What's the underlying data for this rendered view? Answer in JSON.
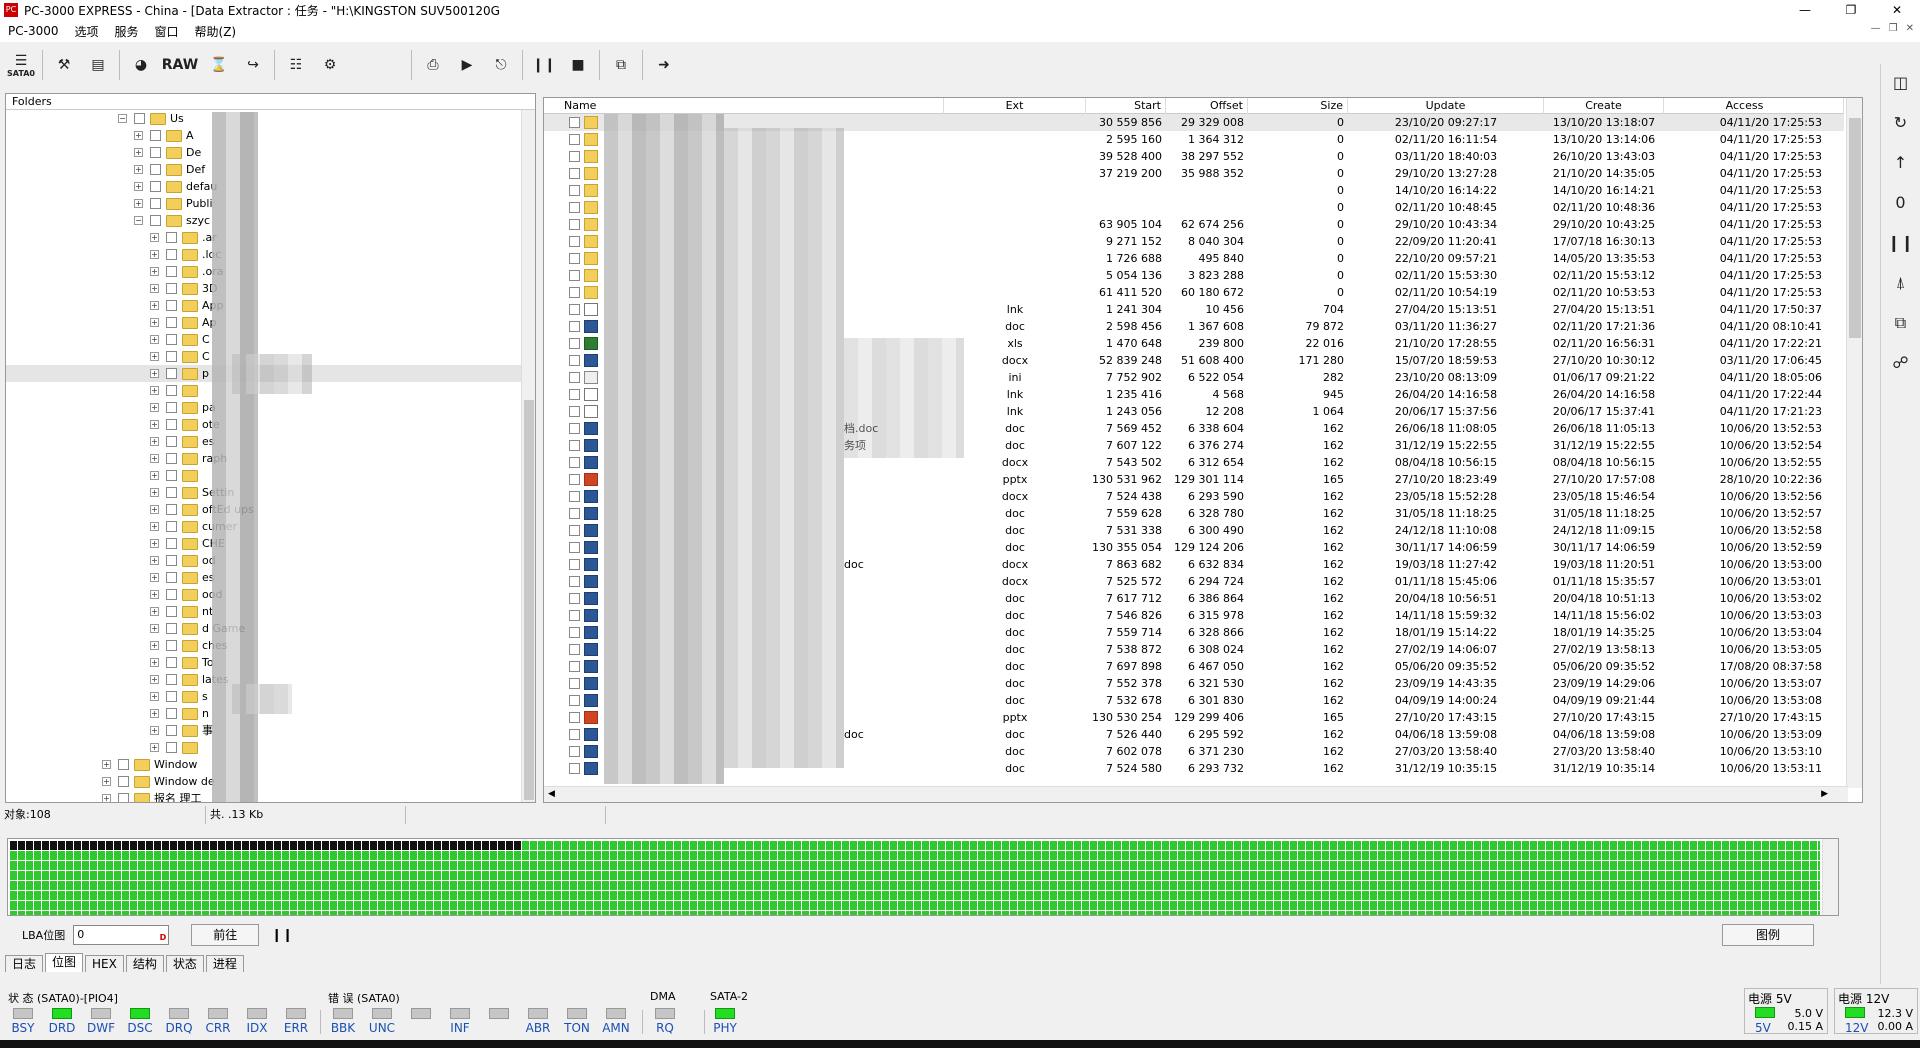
{
  "window": {
    "title": "PC-3000 EXPRESS - China - [Data Extractor : 任务 - \"H:\\KINGSTON SUV500120G"
  },
  "menu": {
    "items": [
      "PC-3000",
      "选项",
      "服务",
      "窗口",
      "帮助(Z)"
    ]
  },
  "toolbar": {
    "sata_label": "SATA0",
    "raw_label": "RAW"
  },
  "folders": {
    "header": "Folders",
    "items": [
      {
        "label": "Us",
        "indent": 0,
        "exp": "−"
      },
      {
        "label": "A",
        "indent": 1,
        "exp": "+"
      },
      {
        "label": "De",
        "indent": 1,
        "exp": "+"
      },
      {
        "label": "Def",
        "indent": 1,
        "exp": "+"
      },
      {
        "label": "defau",
        "indent": 1,
        "exp": "+"
      },
      {
        "label": "Publi",
        "indent": 1,
        "exp": "+"
      },
      {
        "label": "szyc",
        "indent": 1,
        "exp": "−"
      },
      {
        "label": ".ar",
        "indent": 2,
        "exp": "+"
      },
      {
        "label": ".loc",
        "indent": 2,
        "exp": "+"
      },
      {
        "label": ".ora",
        "indent": 2,
        "exp": "+"
      },
      {
        "label": "3D",
        "indent": 2,
        "exp": "+"
      },
      {
        "label": "App",
        "indent": 2,
        "exp": "+"
      },
      {
        "label": "Ap",
        "indent": 2,
        "exp": "+"
      },
      {
        "label": "C",
        "indent": 2,
        "exp": "+"
      },
      {
        "label": "C",
        "indent": 2,
        "exp": "+"
      },
      {
        "label": "p",
        "indent": 2,
        "exp": "+",
        "highlight": true
      },
      {
        "label": "",
        "indent": 2,
        "exp": "+"
      },
      {
        "label": "pa",
        "indent": 2,
        "exp": "+"
      },
      {
        "label": "ote",
        "indent": 2,
        "exp": "+"
      },
      {
        "label": "es",
        "indent": 2,
        "exp": "+"
      },
      {
        "label": "raph",
        "indent": 2,
        "exp": "+"
      },
      {
        "label": "",
        "indent": 2,
        "exp": "+"
      },
      {
        "label": "Settin",
        "indent": 2,
        "exp": "+"
      },
      {
        "label": "oftEd ups",
        "indent": 2,
        "exp": "+"
      },
      {
        "label": "cumer",
        "indent": 2,
        "exp": "+"
      },
      {
        "label": "CHE",
        "indent": 2,
        "exp": "+"
      },
      {
        "label": "od",
        "indent": 2,
        "exp": "+"
      },
      {
        "label": "es",
        "indent": 2,
        "exp": "+"
      },
      {
        "label": "ood",
        "indent": 2,
        "exp": "+"
      },
      {
        "label": "nt",
        "indent": 2,
        "exp": "+"
      },
      {
        "label": "d Game",
        "indent": 2,
        "exp": "+"
      },
      {
        "label": "ches",
        "indent": 2,
        "exp": "+"
      },
      {
        "label": "To",
        "indent": 2,
        "exp": "+"
      },
      {
        "label": "lates",
        "indent": 2,
        "exp": "+"
      },
      {
        "label": "s",
        "indent": 2,
        "exp": "+"
      },
      {
        "label": "n",
        "indent": 2,
        "exp": "+"
      },
      {
        "label": "事",
        "indent": 2,
        "exp": "+"
      },
      {
        "label": "",
        "indent": 2,
        "exp": "+"
      },
      {
        "label": "Window",
        "indent": -1,
        "exp": "+"
      },
      {
        "label": "Window de",
        "indent": -1,
        "exp": "+"
      },
      {
        "label": "报名 理工",
        "indent": -1,
        "exp": "+"
      }
    ]
  },
  "files": {
    "columns": {
      "name": "Name",
      "ext": "Ext",
      "start": "Start",
      "offset": "Offset",
      "size": "Size",
      "update": "Update",
      "create": "Create",
      "access": "Access"
    },
    "rows": [
      {
        "icon": "folder",
        "name": "",
        "ext": "",
        "start": "30 559 856",
        "offset": "29 329 008",
        "size": "0",
        "update": "23/10/20 09:27:17",
        "create": "13/10/20 13:18:07",
        "access": "04/11/20 17:25:53",
        "sel": true
      },
      {
        "icon": "folder",
        "name": "",
        "ext": "",
        "start": "2 595 160",
        "offset": "1 364 312",
        "size": "0",
        "update": "02/11/20 16:11:54",
        "create": "13/10/20 13:14:06",
        "access": "04/11/20 17:25:53"
      },
      {
        "icon": "folder",
        "name": "",
        "ext": "",
        "start": "39 528 400",
        "offset": "38 297 552",
        "size": "0",
        "update": "03/11/20 18:40:03",
        "create": "26/10/20 13:43:03",
        "access": "04/11/20 17:25:53"
      },
      {
        "icon": "folder",
        "name": "",
        "ext": "",
        "start": "37 219 200",
        "offset": "35 988 352",
        "size": "0",
        "update": "29/10/20 13:27:28",
        "create": "21/10/20 14:35:05",
        "access": "04/11/20 17:25:53"
      },
      {
        "icon": "folder",
        "name": "",
        "ext": "",
        "start": "",
        "offset": "",
        "size": "0",
        "update": "14/10/20 16:14:22",
        "create": "14/10/20 16:14:21",
        "access": "04/11/20 17:25:53"
      },
      {
        "icon": "folder",
        "name": "",
        "ext": "",
        "start": "",
        "offset": "",
        "size": "0",
        "update": "02/11/20 10:48:45",
        "create": "02/11/20 10:48:36",
        "access": "04/11/20 17:25:53"
      },
      {
        "icon": "folder",
        "name": "",
        "ext": "",
        "start": "63 905 104",
        "offset": "62 674 256",
        "size": "0",
        "update": "29/10/20 10:43:34",
        "create": "29/10/20 10:43:25",
        "access": "04/11/20 17:25:53"
      },
      {
        "icon": "folder",
        "name": "",
        "ext": "",
        "start": "9 271 152",
        "offset": "8 040 304",
        "size": "0",
        "update": "22/09/20 11:20:41",
        "create": "17/07/18 16:30:13",
        "access": "04/11/20 17:25:53"
      },
      {
        "icon": "folder",
        "name": "",
        "ext": "",
        "start": "1 726 688",
        "offset": "495 840",
        "size": "0",
        "update": "22/10/20 09:57:21",
        "create": "14/05/20 13:35:53",
        "access": "04/11/20 17:25:53"
      },
      {
        "icon": "folder",
        "name": "",
        "ext": "",
        "start": "5 054 136",
        "offset": "3 823 288",
        "size": "0",
        "update": "02/11/20 15:53:30",
        "create": "02/11/20 15:53:12",
        "access": "04/11/20 17:25:53"
      },
      {
        "icon": "folder",
        "name": "",
        "ext": "",
        "start": "61 411 520",
        "offset": "60 180 672",
        "size": "0",
        "update": "02/11/20 10:54:19",
        "create": "02/11/20 10:53:53",
        "access": "04/11/20 17:25:53"
      },
      {
        "icon": "lnk",
        "name": "",
        "ext": "lnk",
        "start": "1 241 304",
        "offset": "10 456",
        "size": "704",
        "update": "27/04/20 15:13:51",
        "create": "27/04/20 15:13:51",
        "access": "04/11/20 17:50:37"
      },
      {
        "icon": "doc",
        "name": "",
        "ext": "doc",
        "start": "2 598 456",
        "offset": "1 367 608",
        "size": "79 872",
        "update": "03/11/20 11:36:27",
        "create": "02/11/20 17:21:36",
        "access": "04/11/20 08:10:41"
      },
      {
        "icon": "xls",
        "name": "",
        "ext": "xls",
        "start": "1 470 648",
        "offset": "239 800",
        "size": "22 016",
        "update": "21/10/20 17:28:55",
        "create": "02/11/20 16:56:31",
        "access": "04/11/20 17:22:21"
      },
      {
        "icon": "doc",
        "name": "",
        "ext": "docx",
        "start": "52 839 248",
        "offset": "51 608 400",
        "size": "171 280",
        "update": "15/07/20 18:59:53",
        "create": "27/10/20 10:30:12",
        "access": "03/11/20 17:06:45"
      },
      {
        "icon": "ini",
        "name": "",
        "ext": "ini",
        "start": "7 752 902",
        "offset": "6 522 054",
        "size": "282",
        "update": "23/10/20 08:13:09",
        "create": "01/06/17 09:21:22",
        "access": "04/11/20 18:05:06"
      },
      {
        "icon": "lnk",
        "name": "",
        "ext": "lnk",
        "start": "1 235 416",
        "offset": "4 568",
        "size": "945",
        "update": "26/04/20 14:16:58",
        "create": "26/04/20 14:16:58",
        "access": "04/11/20 17:22:44"
      },
      {
        "icon": "lnk",
        "name": "",
        "ext": "lnk",
        "start": "1 243 056",
        "offset": "12 208",
        "size": "1 064",
        "update": "20/06/17 15:37:56",
        "create": "20/06/17 15:37:41",
        "access": "04/11/20 17:21:23"
      },
      {
        "icon": "doc",
        "name": "档.doc",
        "ext": "doc",
        "start": "7 569 452",
        "offset": "6 338 604",
        "size": "162",
        "update": "26/06/18 11:08:05",
        "create": "26/06/18 11:05:13",
        "access": "10/06/20 13:52:53"
      },
      {
        "icon": "doc",
        "name": "务项",
        "ext": "doc",
        "start": "7 607 122",
        "offset": "6 376 274",
        "size": "162",
        "update": "31/12/19 15:22:55",
        "create": "31/12/19 15:22:55",
        "access": "10/06/20 13:52:54"
      },
      {
        "icon": "doc",
        "name": "",
        "ext": "docx",
        "start": "7 543 502",
        "offset": "6 312 654",
        "size": "162",
        "update": "08/04/18 10:56:15",
        "create": "08/04/18 10:56:15",
        "access": "10/06/20 13:52:55"
      },
      {
        "icon": "ppt",
        "name": "",
        "ext": "pptx",
        "start": "130 531 962",
        "offset": "129 301 114",
        "size": "165",
        "update": "27/10/20 18:23:49",
        "create": "27/10/20 17:57:08",
        "access": "28/10/20 10:22:36"
      },
      {
        "icon": "doc",
        "name": "",
        "ext": "docx",
        "start": "7 524 438",
        "offset": "6 293 590",
        "size": "162",
        "update": "23/05/18 15:52:28",
        "create": "23/05/18 15:46:54",
        "access": "10/06/20 13:52:56"
      },
      {
        "icon": "doc",
        "name": "",
        "ext": "doc",
        "start": "7 559 628",
        "offset": "6 328 780",
        "size": "162",
        "update": "31/05/18 11:18:25",
        "create": "31/05/18 11:18:25",
        "access": "10/06/20 13:52:57"
      },
      {
        "icon": "doc",
        "name": "",
        "ext": "doc",
        "start": "7 531 338",
        "offset": "6 300 490",
        "size": "162",
        "update": "24/12/18 11:10:08",
        "create": "24/12/18 11:09:15",
        "access": "10/06/20 13:52:58"
      },
      {
        "icon": "doc",
        "name": "",
        "ext": "doc",
        "start": "130 355 054",
        "offset": "129 124 206",
        "size": "162",
        "update": "30/11/17 14:06:59",
        "create": "30/11/17 14:06:59",
        "access": "10/06/20 13:52:59"
      },
      {
        "icon": "doc",
        "name": "doc",
        "ext": "docx",
        "start": "7 863 682",
        "offset": "6 632 834",
        "size": "162",
        "update": "19/03/18 11:27:42",
        "create": "19/03/18 11:20:51",
        "access": "10/06/20 13:53:00"
      },
      {
        "icon": "doc",
        "name": "",
        "ext": "docx",
        "start": "7 525 572",
        "offset": "6 294 724",
        "size": "162",
        "update": "01/11/18 15:45:06",
        "create": "01/11/18 15:35:57",
        "access": "10/06/20 13:53:01"
      },
      {
        "icon": "doc",
        "name": "",
        "ext": "doc",
        "start": "7 617 712",
        "offset": "6 386 864",
        "size": "162",
        "update": "20/04/18 10:56:51",
        "create": "20/04/18 10:51:13",
        "access": "10/06/20 13:53:02"
      },
      {
        "icon": "doc",
        "name": "",
        "ext": "doc",
        "start": "7 546 826",
        "offset": "6 315 978",
        "size": "162",
        "update": "14/11/18 15:59:32",
        "create": "14/11/18 15:56:02",
        "access": "10/06/20 13:53:03"
      },
      {
        "icon": "doc",
        "name": "",
        "ext": "doc",
        "start": "7 559 714",
        "offset": "6 328 866",
        "size": "162",
        "update": "18/01/19 15:14:22",
        "create": "18/01/19 14:35:25",
        "access": "10/06/20 13:53:04"
      },
      {
        "icon": "doc",
        "name": "",
        "ext": "doc",
        "start": "7 538 872",
        "offset": "6 308 024",
        "size": "162",
        "update": "27/02/19 14:06:07",
        "create": "27/02/19 13:58:13",
        "access": "10/06/20 13:53:05"
      },
      {
        "icon": "doc",
        "name": "",
        "ext": "doc",
        "start": "7 697 898",
        "offset": "6 467 050",
        "size": "162",
        "update": "05/06/20 09:35:52",
        "create": "05/06/20 09:35:52",
        "access": "17/08/20 08:37:58"
      },
      {
        "icon": "doc",
        "name": "",
        "ext": "doc",
        "start": "7 552 378",
        "offset": "6 321 530",
        "size": "162",
        "update": "23/09/19 14:43:35",
        "create": "23/09/19 14:29:06",
        "access": "10/06/20 13:53:07"
      },
      {
        "icon": "doc",
        "name": "",
        "ext": "doc",
        "start": "7 532 678",
        "offset": "6 301 830",
        "size": "162",
        "update": "04/09/19 14:00:24",
        "create": "04/09/19 09:21:44",
        "access": "10/06/20 13:53:08"
      },
      {
        "icon": "ppt",
        "name": "",
        "ext": "pptx",
        "start": "130 530 254",
        "offset": "129 299 406",
        "size": "165",
        "update": "27/10/20 17:43:15",
        "create": "27/10/20 17:43:15",
        "access": "27/10/20 17:43:15"
      },
      {
        "icon": "doc",
        "name": "doc",
        "ext": "doc",
        "start": "7 526 440",
        "offset": "6 295 592",
        "size": "162",
        "update": "04/06/18 13:59:08",
        "create": "04/06/18 13:59:08",
        "access": "10/06/20 13:53:09"
      },
      {
        "icon": "doc",
        "name": "",
        "ext": "doc",
        "start": "7 602 078",
        "offset": "6 371 230",
        "size": "162",
        "update": "27/03/20 13:58:40",
        "create": "27/03/20 13:58:40",
        "access": "10/06/20 13:53:10"
      },
      {
        "icon": "doc",
        "name": "",
        "ext": "doc",
        "start": "7 524 580",
        "offset": "6 293 732",
        "size": "162",
        "update": "31/12/19 10:35:15",
        "create": "31/12/19 10:35:14",
        "access": "10/06/20 13:53:11"
      }
    ]
  },
  "status": {
    "objects": "对象:108",
    "total": "共.  .13 Kb"
  },
  "bitmap": {
    "filled_fraction": 0.283
  },
  "lba": {
    "label": "LBA位图",
    "value": "0",
    "goto": "前往",
    "legend": "图例"
  },
  "tabs": [
    "日志",
    "位图",
    "HEX",
    "结构",
    "状态",
    "进程"
  ],
  "active_tab": "位图",
  "leds": {
    "state_title": "状 态 (SATA0)-[PIO4]",
    "error_title": "错 误 (SATA0)",
    "dma_title": "DMA",
    "sata_title": "SATA-2",
    "state": [
      {
        "n": "BSY",
        "on": false
      },
      {
        "n": "DRD",
        "on": true
      },
      {
        "n": "DWF",
        "on": false
      },
      {
        "n": "DSC",
        "on": true
      },
      {
        "n": "DRQ",
        "on": false
      },
      {
        "n": "CRR",
        "on": false
      },
      {
        "n": "IDX",
        "on": false
      },
      {
        "n": "ERR",
        "on": false
      }
    ],
    "error": [
      {
        "n": "BBK",
        "on": false
      },
      {
        "n": "UNC",
        "on": false
      },
      {
        "n": "",
        "on": false
      },
      {
        "n": "INF",
        "on": false
      },
      {
        "n": "",
        "on": false
      },
      {
        "n": "ABR",
        "on": false
      },
      {
        "n": "TON",
        "on": false
      },
      {
        "n": "AMN",
        "on": false
      }
    ],
    "dma": [
      {
        "n": "RQ",
        "on": false
      }
    ],
    "sata": [
      {
        "n": "PHY",
        "on": true
      }
    ]
  },
  "power": {
    "p5": {
      "title": "电源 5V",
      "name": "5V",
      "v1": "5.0 V",
      "v2": "0.15 A"
    },
    "p12": {
      "title": "电源 12V",
      "name": "12V",
      "v1": "12.3 V",
      "v2": "0.00 A"
    }
  }
}
